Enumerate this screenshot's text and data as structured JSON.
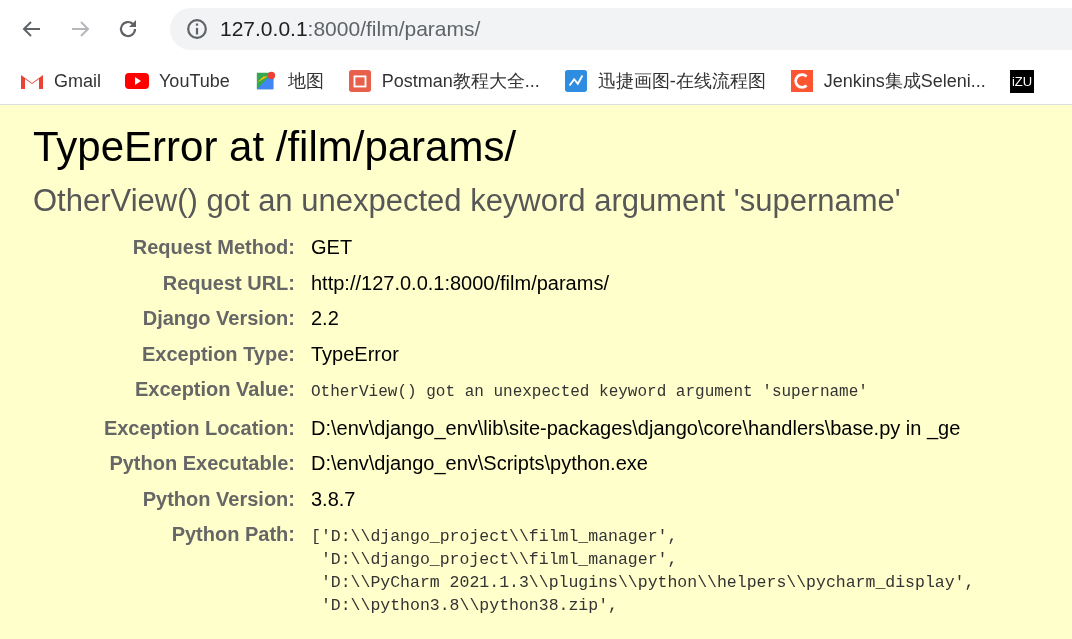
{
  "browser": {
    "url_host": "127.0.0.1",
    "url_path": ":8000/film/params/",
    "bookmarks": [
      {
        "label": "Gmail",
        "kind": "gmail"
      },
      {
        "label": "YouTube",
        "kind": "youtube"
      },
      {
        "label": "地图",
        "kind": "maps"
      },
      {
        "label": "Postman教程大全...",
        "kind": "jian"
      },
      {
        "label": "迅捷画图-在线流程图",
        "kind": "chart"
      },
      {
        "label": "Jenkins集成Seleni...",
        "kind": "c"
      },
      {
        "label": "iZU",
        "kind": "izu"
      }
    ]
  },
  "error": {
    "title": "TypeError at /film/params/",
    "message": "OtherView() got an unexpected keyword argument 'supername'",
    "meta": [
      {
        "label": "Request Method:",
        "value": "GET",
        "kind": "text"
      },
      {
        "label": "Request URL:",
        "value": "http://127.0.0.1:8000/film/params/",
        "kind": "text"
      },
      {
        "label": "Django Version:",
        "value": "2.2",
        "kind": "text"
      },
      {
        "label": "Exception Type:",
        "value": "TypeError",
        "kind": "text"
      },
      {
        "label": "Exception Value:",
        "value": "OtherView() got an unexpected keyword argument 'supername'",
        "kind": "code"
      },
      {
        "label": "Exception Location:",
        "value": "D:\\env\\django_env\\lib\\site-packages\\django\\core\\handlers\\base.py in _ge",
        "kind": "text"
      },
      {
        "label": "Python Executable:",
        "value": "D:\\env\\django_env\\Scripts\\python.exe",
        "kind": "text"
      },
      {
        "label": "Python Version:",
        "value": "3.8.7",
        "kind": "text"
      },
      {
        "label": "Python Path:",
        "lines": [
          "['D:\\\\django_project\\\\filml_manager',",
          " 'D:\\\\django_project\\\\filml_manager',",
          " 'D:\\\\PyCharm 2021.1.3\\\\plugins\\\\python\\\\helpers\\\\pycharm_display',",
          " 'D:\\\\python3.8\\\\python38.zip',"
        ],
        "kind": "lines"
      }
    ]
  }
}
